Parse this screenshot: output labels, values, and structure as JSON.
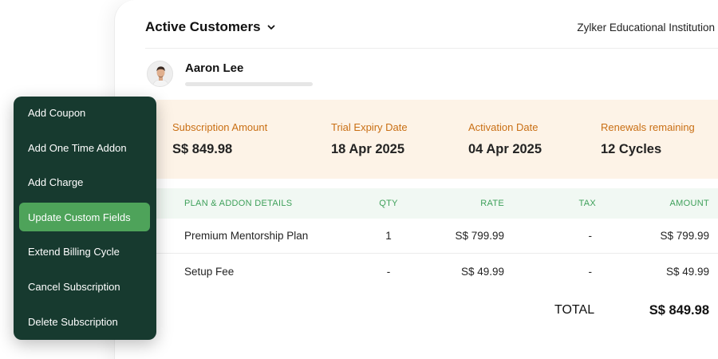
{
  "header": {
    "view_title": "Active Customers",
    "organization": "Zylker Educational Institution"
  },
  "customer": {
    "name": "Aaron Lee"
  },
  "summary": [
    {
      "label": "Subscription Amount",
      "value": "S$ 849.98"
    },
    {
      "label": "Trial Expiry Date",
      "value": "18 Apr 2025"
    },
    {
      "label": "Activation Date",
      "value": "04 Apr 2025"
    },
    {
      "label": "Renewals remaining",
      "value": "12 Cycles"
    }
  ],
  "items_table": {
    "columns": [
      "PLAN & ADDON DETAILS",
      "QTY",
      "RATE",
      "TAX",
      "AMOUNT"
    ],
    "rows": [
      {
        "name": "Premium Mentorship Plan",
        "qty": "1",
        "rate": "S$ 799.99",
        "tax": "-",
        "amount": "S$ 799.99"
      },
      {
        "name": "Setup Fee",
        "qty": "-",
        "rate": "S$ 49.99",
        "tax": "-",
        "amount": "S$ 49.99"
      }
    ],
    "total_label": "TOTAL",
    "total_value": "S$ 849.98"
  },
  "actions_menu": {
    "items": [
      "Add Coupon",
      "Add One Time Addon",
      "Add Charge",
      "Update Custom Fields",
      "Extend Billing Cycle",
      "Cancel Subscription",
      "Delete Subscription"
    ],
    "active_item": "Update Custom Fields"
  },
  "colors": {
    "menu_background": "#173a2f",
    "menu_active": "#4ea35a",
    "summary_background": "#fdf3e7",
    "summary_label": "#c96f14",
    "table_header_text": "#3ea05a",
    "table_header_background": "#f1f8f3"
  }
}
